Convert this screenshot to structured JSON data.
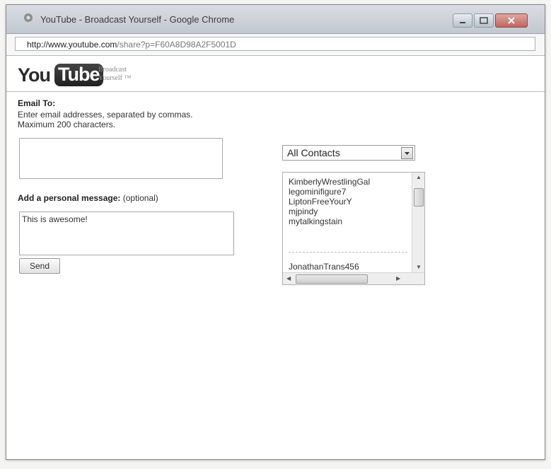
{
  "window": {
    "title": "YouTube - Broadcast Yourself - Google Chrome"
  },
  "address_bar": {
    "url_host": "http://www.youtube.com",
    "url_path": "/share?p=F60A8D98A2F5001D"
  },
  "logo": {
    "you": "You",
    "tube": "Tube",
    "tagline_1": "Broadcast",
    "tagline_2": "Yourself ™"
  },
  "email": {
    "label": "Email To:",
    "help_line_1": "Enter email addresses, separated by commas.",
    "help_line_2": "Maximum 200 characters.",
    "value": ""
  },
  "message": {
    "label": "Add a personal message:",
    "optional": "(optional)",
    "value": "This is awesome!"
  },
  "send_button": "Send",
  "contacts": {
    "selected": "All Contacts",
    "items": [
      "KimberlyWrestlingGal",
      "legominifigure7",
      "LiptonFreeYourY",
      "mjpindy",
      "mytalkingstain"
    ],
    "extra_item": "JonathanTrans456"
  },
  "colors": {
    "window_bg": "#ffffff",
    "titlebar": "#c8cdd3",
    "close_button": "#c2665c"
  }
}
